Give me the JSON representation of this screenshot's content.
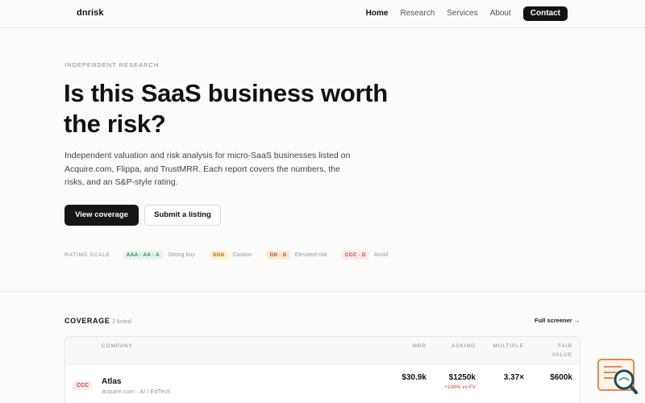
{
  "nav": {
    "logo": "dnrisk",
    "links": [
      "Home",
      "Research",
      "Services",
      "About"
    ],
    "contact": "Contact"
  },
  "hero": {
    "eyebrow": "INDEPENDENT RESEARCH",
    "title_line1": "Is this SaaS business worth",
    "title_line2": "the risk?",
    "lead": "Independent valuation and risk analysis for micro-SaaS businesses listed on Acquire.com, Flippa, and TrustMRR. Each report covers the numbers, the risks, and an S&P-style rating.",
    "primary_button": "View coverage",
    "secondary_button": "Submit a listing"
  },
  "rating_scale": {
    "label": "RATING SCALE",
    "items": [
      {
        "grade": "AAA · AA · A",
        "desc": "Strong buy",
        "color": "#1f8a4c",
        "bg": "#e4f5ea"
      },
      {
        "grade": "BBB",
        "desc": "Caution",
        "color": "#c77a12",
        "bg": "#fdf1dc"
      },
      {
        "grade": "BB · B",
        "desc": "Elevated risk",
        "color": "#d3601c",
        "bg": "#fde9dc"
      },
      {
        "grade": "CCC · D",
        "desc": "Avoid",
        "color": "#d23b3b",
        "bg": "#fde9e9"
      }
    ]
  },
  "coverage": {
    "title": "COVERAGE",
    "count": "2 listed",
    "full_screener": "Full screener →",
    "columns": {
      "company": "COMPANY",
      "mrr": "MRR",
      "asking": "ASKING",
      "multiple": "MULTIPLE",
      "fair_value_1": "FAIR",
      "fair_value_2": "VALUE"
    },
    "rows": [
      {
        "rating": "CCC",
        "company": "Atlas",
        "source": "acquire.com · AI / EdTech",
        "mrr": "$30.9k",
        "asking": "$1250k",
        "asking_note": "+108% vs FV",
        "multiple": "3.37×",
        "fair_value": "$600k"
      }
    ]
  },
  "widget": {
    "icon": "search-document-icon"
  }
}
